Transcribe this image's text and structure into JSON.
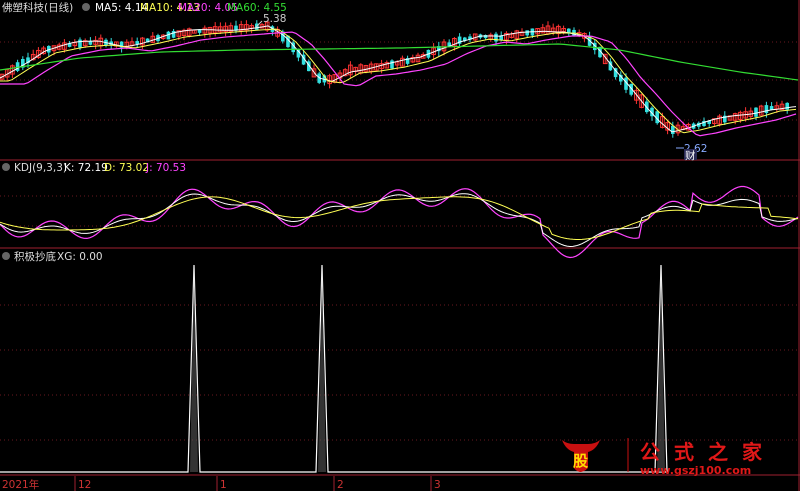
{
  "panels": {
    "price": {
      "title": "佛塑科技(日线)",
      "ma": [
        {
          "label": "MA5: 4.14",
          "color": "#ffffff"
        },
        {
          "label": "MA10: 4.13",
          "color": "#ffff55"
        },
        {
          "label": "MA20: 4.05",
          "color": "#ff44ff"
        },
        {
          "label": "MA60: 4.55",
          "color": "#33dd33"
        }
      ],
      "high_label": "5.38",
      "low_label": "2.62",
      "event_label": "财"
    },
    "kdj": {
      "title": "KDJ(9,3,3)",
      "k": "K: 72.19",
      "d": "D: 73.02",
      "j": "J: 70.53",
      "colors": {
        "k": "#ffffff",
        "d": "#ffff55",
        "j": "#ff44ff"
      }
    },
    "signal": {
      "title": "积极抄底",
      "xg": "XG: 0.00"
    }
  },
  "x_axis": {
    "labels": [
      "2021年",
      "12",
      "1",
      "2",
      "3"
    ]
  },
  "watermark": {
    "logo_char": "股",
    "text": "公式之家",
    "url": "www.gszj100.com"
  },
  "chart_data": [
    {
      "type": "candlestick",
      "title": "佛塑科技(日线)",
      "series": [
        {
          "name": "MA5",
          "value": 4.14
        },
        {
          "name": "MA10",
          "value": 4.13
        },
        {
          "name": "MA20",
          "value": 4.05
        },
        {
          "name": "MA60",
          "value": 4.55
        }
      ],
      "annotations": [
        {
          "text": "5.38",
          "kind": "high"
        },
        {
          "text": "2.62",
          "kind": "low"
        },
        {
          "text": "财",
          "kind": "event"
        }
      ]
    },
    {
      "type": "line",
      "title": "KDJ(9,3,3)",
      "series": [
        {
          "name": "K",
          "last": 72.19
        },
        {
          "name": "D",
          "last": 73.02
        },
        {
          "name": "J",
          "last": 70.53
        }
      ]
    },
    {
      "type": "line",
      "title": "积极抄底",
      "series": [
        {
          "name": "XG",
          "last": 0.0
        }
      ],
      "signal_days": [
        1,
        2,
        3
      ]
    }
  ]
}
